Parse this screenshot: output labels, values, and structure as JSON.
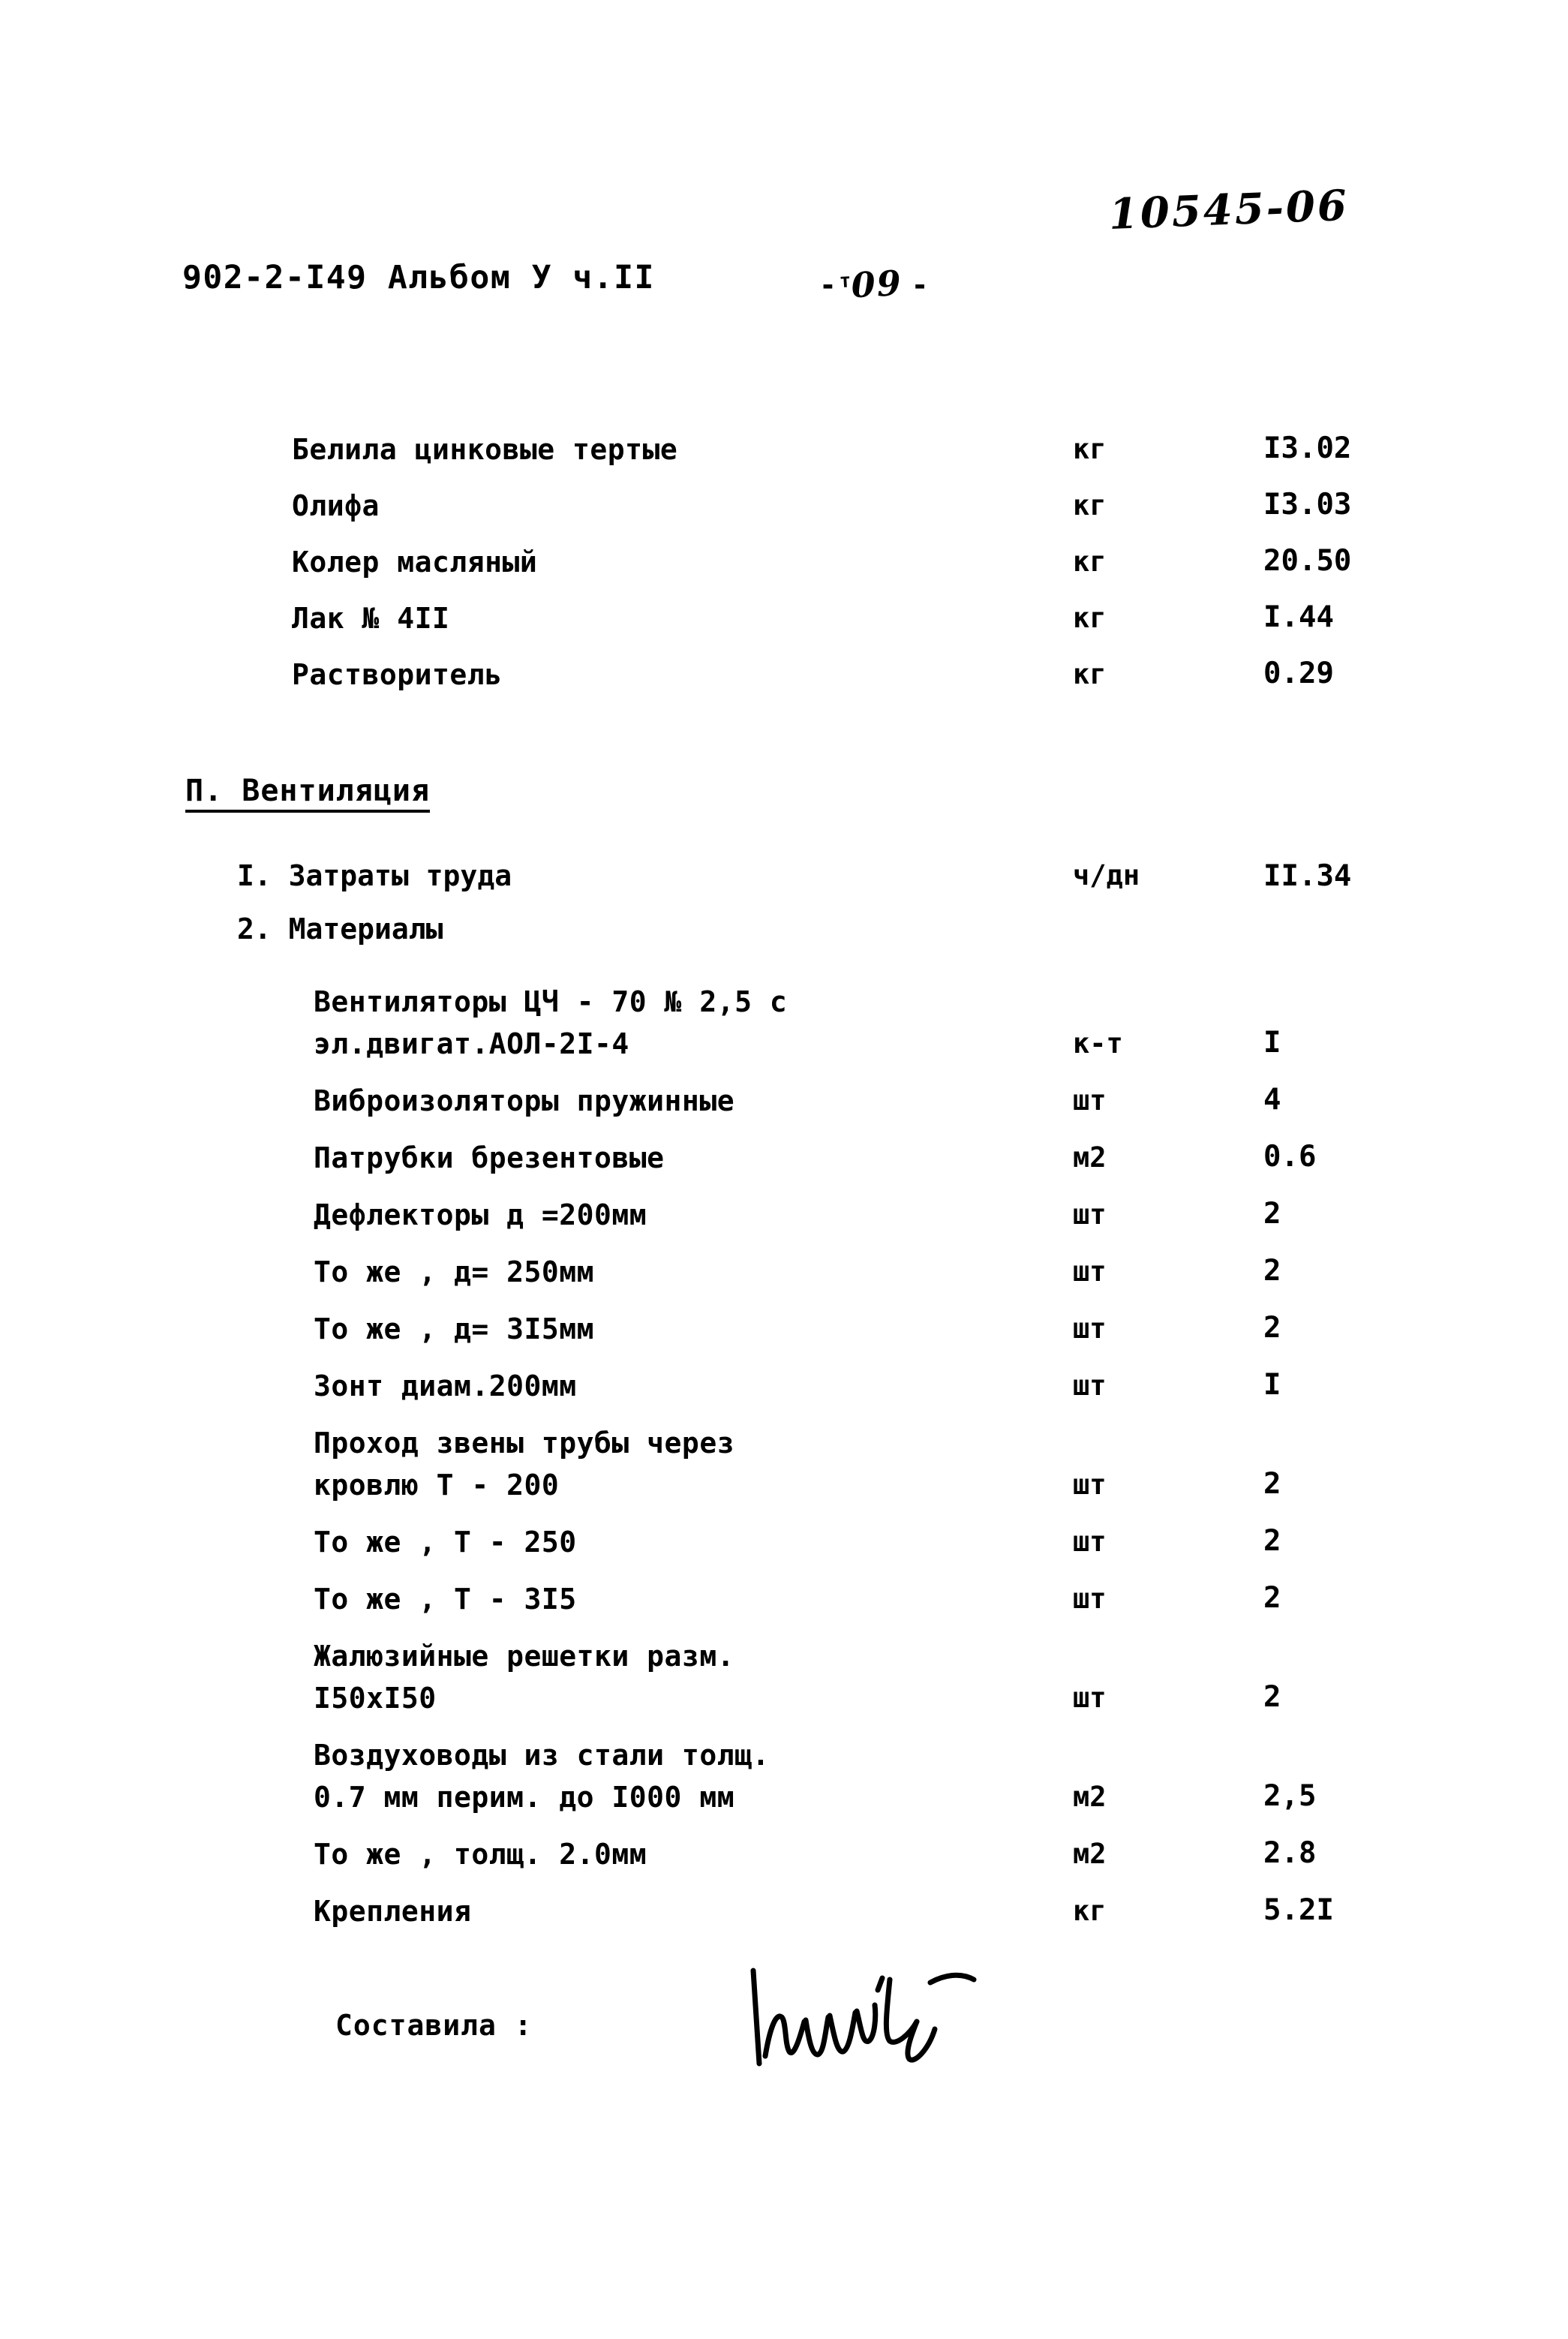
{
  "document": {
    "stamp_number": "10545-06",
    "doc_code": "902-2-I49  Альбом У ч.II",
    "page_marker_left": "-",
    "page_marker_right": "-",
    "page_number": "09",
    "page_number_prefix": "т"
  },
  "paint_materials": {
    "rows": [
      {
        "name": "Белила цинковые тертые",
        "unit": "кг",
        "value": "I3.02"
      },
      {
        "name": "Олифа",
        "unit": "кг",
        "value": "I3.03"
      },
      {
        "name": "Колер масляный",
        "unit": "кг",
        "value": "20.50"
      },
      {
        "name": "Лак № 4II",
        "unit": "кг",
        "value": "I.44"
      },
      {
        "name": "Растворитель",
        "unit": "кг",
        "value": "0.29"
      }
    ]
  },
  "ventilation": {
    "heading": "П. Вентиляция",
    "labor": {
      "number": "I.",
      "name": "Затраты труда",
      "unit": "ч/дн",
      "value": "II.34"
    },
    "materials_heading": {
      "number": "2.",
      "name": "Материалы"
    },
    "rows": [
      {
        "name": "Вентиляторы ЦЧ - 70 № 2,5 с",
        "name2": "эл.двигат.АОЛ-2I-4",
        "unit": "к-т",
        "value": "I"
      },
      {
        "name": "Виброизоляторы пружинные",
        "name2": "",
        "unit": "шт",
        "value": "4"
      },
      {
        "name": "Патрубки брезентовые",
        "name2": "",
        "unit": "м2",
        "value": "0.6"
      },
      {
        "name": "Дефлекторы д =200мм",
        "name2": "",
        "unit": "шт",
        "value": "2"
      },
      {
        "name": "То же , д= 250мм",
        "name2": "",
        "unit": "шт",
        "value": "2"
      },
      {
        "name": "То же , д= 3I5мм",
        "name2": "",
        "unit": "шт",
        "value": "2"
      },
      {
        "name": "Зонт диам.200мм",
        "name2": "",
        "unit": "шт",
        "value": "I"
      },
      {
        "name": "Проход звены трубы через",
        "name2": "кровлю Т - 200",
        "unit": "шт",
        "value": "2"
      },
      {
        "name": "То же , Т - 250",
        "name2": "",
        "unit": "шт",
        "value": "2"
      },
      {
        "name": "То же , Т - 3I5",
        "name2": "",
        "unit": "шт",
        "value": "2"
      },
      {
        "name": "Жалюзийные решетки разм.",
        "name2": "I50xI50",
        "unit": "шт",
        "value": "2"
      },
      {
        "name": "Воздуховоды из стали толщ.",
        "name2": "0.7 мм перим. до I000 мм",
        "unit": "м2",
        "value": "2,5"
      },
      {
        "name": "То же , толщ. 2.0мм",
        "name2": "",
        "unit": "м2",
        "value": "2.8"
      },
      {
        "name": "Крепления",
        "name2": "",
        "unit": "кг",
        "value": "5.2I"
      }
    ]
  },
  "footer": {
    "signer_label": "Составила :",
    "signature_present": true
  }
}
